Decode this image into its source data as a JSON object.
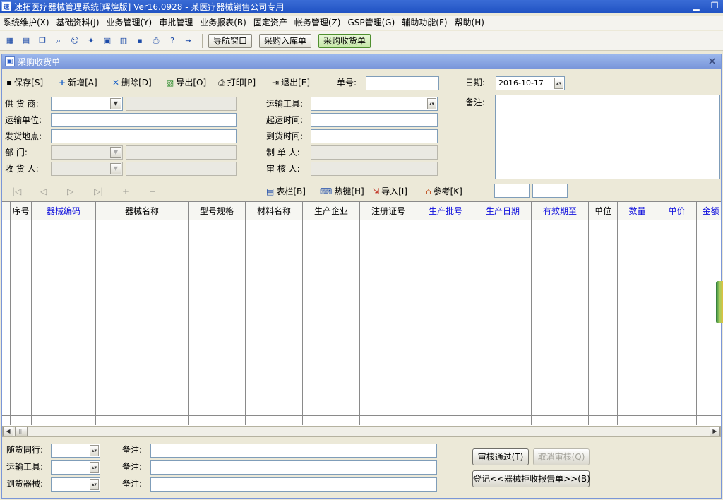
{
  "window": {
    "title": "速拓医疗器械管理系统[辉煌版] Ver16.0928  -  某医疗器械销售公司专用",
    "min_glyph": "▁",
    "restore_glyph": "❐",
    "close_glyph": "✕"
  },
  "menu": [
    "系统维护(X)",
    "基础资料(J)",
    "业务管理(Y)",
    "审批管理",
    "业务报表(B)",
    "固定资产",
    "帐务管理(Z)",
    "GSP管理(G)",
    "辅助功能(F)",
    "帮助(H)"
  ],
  "toolbar": {
    "icons": [
      "grid-icon",
      "card-icon",
      "window-icon",
      "search-icon",
      "users-icon",
      "tools-icon",
      "print-preview-icon",
      "calculator-icon",
      "save-disk-icon",
      "printer-icon",
      "help-icon",
      "exit-door-icon"
    ],
    "icon_glyphs": [
      "▦",
      "▤",
      "❐",
      "⌕",
      "☺",
      "✦",
      "▣",
      "▥",
      "▪",
      "⎙",
      "?",
      "⇥"
    ],
    "nav_button": "导航窗口",
    "purchase_in_button": "采购入库单",
    "purchase_receive_button": "采购收货单"
  },
  "form": {
    "title": "采购收货单",
    "icon_glyph": "▣",
    "close_glyph": "✕",
    "actions": {
      "save": "保存[S]",
      "add": "新增[A]",
      "delete": "删除[D]",
      "export": "导出[O]",
      "print": "打印[P]",
      "exit": "退出[E]"
    },
    "action_glyphs": {
      "save": "▪",
      "add": "+",
      "delete": "✕",
      "export": "▧",
      "print": "⎙",
      "exit": "⇥"
    },
    "order_no_label": "单号:",
    "order_no_value": "",
    "date_label": "日期:",
    "date_value": "2016-10-17",
    "fields": {
      "supplier_label": "供 货 商:",
      "transport_unit_label": "运输单位:",
      "ship_place_label": "发货地点:",
      "department_label": "部    门:",
      "receiver_label": "收 货 人:",
      "transport_tool_label": "运输工具:",
      "depart_time_label": "起运时间:",
      "arrive_time_label": "到货时间:",
      "maker_label": "制 单 人:",
      "auditor_label": "审 核 人:",
      "remark_label": "备注:"
    },
    "grid_tools": {
      "nav_glyphs": [
        "|◁",
        "◁",
        "▷",
        "▷|",
        "+",
        "−"
      ],
      "columns_btn": "表栏[B]",
      "hotkey_btn": "热键[H]",
      "import_btn": "导入[I]",
      "reference_btn": "参考[K]",
      "columns_glyph": "▤",
      "hotkey_glyph": "⌨",
      "import_glyph": "⇲",
      "reference_glyph": "⌂"
    },
    "table": {
      "columns": [
        {
          "label": "序号",
          "color": "#000000"
        },
        {
          "label": "器械编码",
          "color": "#1010dd"
        },
        {
          "label": "器械名称",
          "color": "#000000"
        },
        {
          "label": "型号规格",
          "color": "#000000"
        },
        {
          "label": "材料名称",
          "color": "#000000"
        },
        {
          "label": "生产企业",
          "color": "#000000"
        },
        {
          "label": "注册证号",
          "color": "#000000"
        },
        {
          "label": "生产批号",
          "color": "#1010dd"
        },
        {
          "label": "生产日期",
          "color": "#1010dd"
        },
        {
          "label": "有效期至",
          "color": "#1010dd"
        },
        {
          "label": "单位",
          "color": "#000000"
        },
        {
          "label": "数量",
          "color": "#1010dd"
        },
        {
          "label": "单价",
          "color": "#1010dd"
        },
        {
          "label": "金额",
          "color": "#1010dd"
        }
      ],
      "rows": []
    },
    "scroll": {
      "left": "◀",
      "right": "▶",
      "thumb": "|||"
    },
    "bottom": {
      "accompany_label": "随货同行:",
      "transport_tool_label": "运输工具:",
      "arrive_device_label": "到货器械:",
      "remark_label": "备注:",
      "approve_btn": "审核通过(T)",
      "cancel_approve_btn": "取消审核(Q)",
      "register_btn": "登记<<器械拒收报告单>>(B)"
    }
  }
}
